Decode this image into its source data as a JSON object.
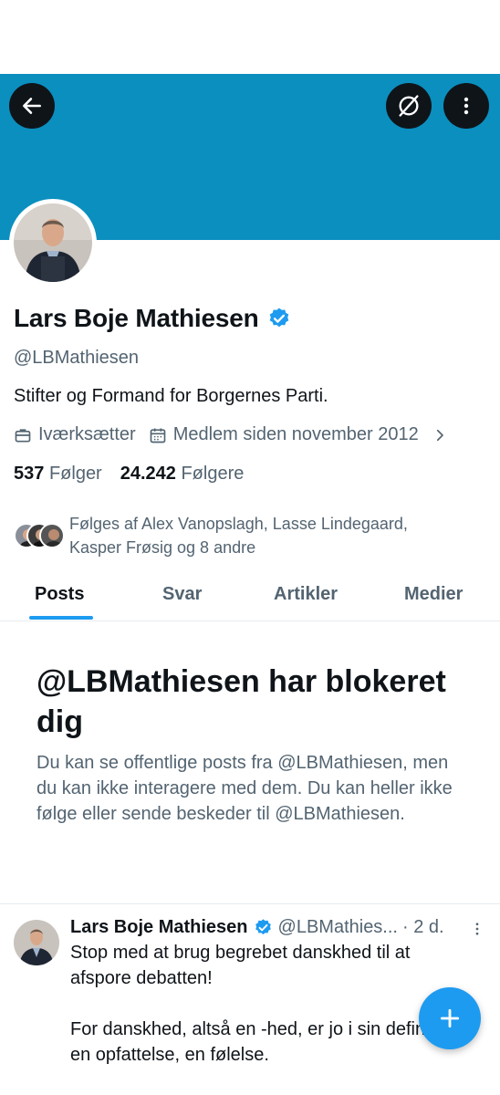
{
  "profile": {
    "name": "Lars Boje Mathiesen",
    "handle": "@LBMathiesen",
    "bio": "Stifter og Formand for Borgernes Parti.",
    "profession": "Iværksætter",
    "joined": "Medlem siden november 2012",
    "following_count": "537",
    "following_label": "Følger",
    "followers_count": "24.242",
    "followers_label": "Følgere",
    "followed_by": "Følges af Alex Vanopslagh, Lasse Lindegaard, Kasper Frøsig og 8 andre"
  },
  "tabs": [
    {
      "label": "Posts",
      "active": true
    },
    {
      "label": "Svar"
    },
    {
      "label": "Artikler"
    },
    {
      "label": "Medier"
    }
  ],
  "blocked": {
    "title": "@LBMathiesen har blokeret dig",
    "text": "Du kan se offentlige posts fra @LBMathiesen, men du kan ikke interagere med dem. Du kan heller ikke følge eller sende beskeder til @LBMathiesen."
  },
  "tweet": {
    "name": "Lars Boje Mathiesen",
    "handle": "@LBMathies...",
    "time": "· 2 d.",
    "paragraphs": [
      "Stop med at brug begrebet danskhed til at afspore debatten!",
      "For danskhed, altså en -hed, er jo i sin definition en opfattelse, en følelse."
    ]
  },
  "colors": {
    "banner": "#0b8fbf",
    "accent": "#1d9bf0",
    "verified": "#1d9bf0",
    "secondary_text": "#536471"
  },
  "icons": [
    "back-arrow-icon",
    "disconnect-icon",
    "more-vertical-icon",
    "verified-badge-icon",
    "briefcase-icon",
    "calendar-icon",
    "chevron-right-icon",
    "more-horizontal-icon",
    "plus-icon"
  ]
}
